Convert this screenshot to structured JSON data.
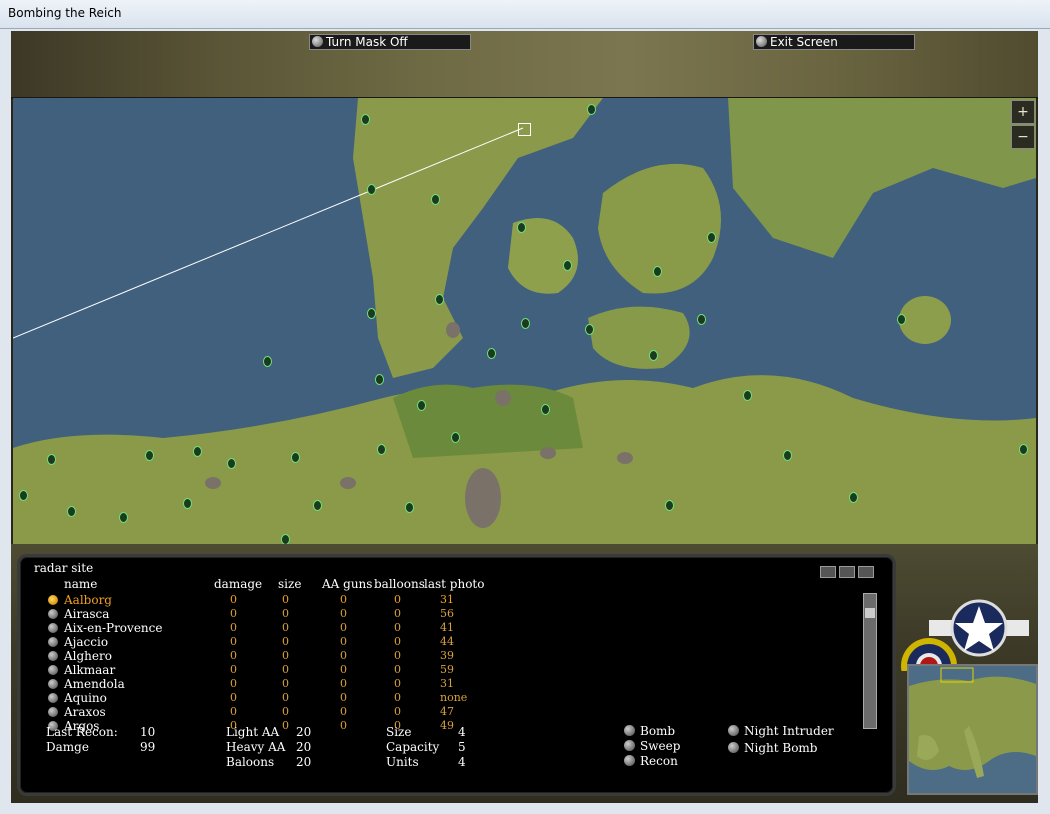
{
  "window": {
    "title": "Bombing the Reich"
  },
  "toolbar": {
    "mask_button": "Turn Mask Off",
    "exit_button": "Exit Screen"
  },
  "map": {
    "zoom_in": "+",
    "zoom_out": "−"
  },
  "panel": {
    "title": "radar site",
    "columns": [
      "name",
      "damage",
      "size",
      "AA guns",
      "balloons",
      "last photo"
    ],
    "rows": [
      {
        "name": "Aalborg",
        "damage": "0",
        "size": "0",
        "aa": "0",
        "balloons": "0",
        "photo": "31",
        "selected": true
      },
      {
        "name": "Airasca",
        "damage": "0",
        "size": "0",
        "aa": "0",
        "balloons": "0",
        "photo": "56"
      },
      {
        "name": "Aix-en-Provence",
        "damage": "0",
        "size": "0",
        "aa": "0",
        "balloons": "0",
        "photo": "41"
      },
      {
        "name": "Ajaccio",
        "damage": "0",
        "size": "0",
        "aa": "0",
        "balloons": "0",
        "photo": "44"
      },
      {
        "name": "Alghero",
        "damage": "0",
        "size": "0",
        "aa": "0",
        "balloons": "0",
        "photo": "39"
      },
      {
        "name": "Alkmaar",
        "damage": "0",
        "size": "0",
        "aa": "0",
        "balloons": "0",
        "photo": "59"
      },
      {
        "name": "Amendola",
        "damage": "0",
        "size": "0",
        "aa": "0",
        "balloons": "0",
        "photo": "31"
      },
      {
        "name": "Aquino",
        "damage": "0",
        "size": "0",
        "aa": "0",
        "balloons": "0",
        "photo": "none"
      },
      {
        "name": "Araxos",
        "damage": "0",
        "size": "0",
        "aa": "0",
        "balloons": "0",
        "photo": "47"
      },
      {
        "name": "Argos",
        "damage": "0",
        "size": "0",
        "aa": "0",
        "balloons": "0",
        "photo": "49"
      }
    ],
    "stats": {
      "last_recon_label": "Last Recon:",
      "last_recon": "10",
      "damage_label": "Damge",
      "damage": "99",
      "light_aa_label": "Light AA",
      "light_aa": "20",
      "heavy_aa_label": "Heavy AA",
      "heavy_aa": "20",
      "balloons_label": "Baloons",
      "balloons": "20",
      "size_label": "Size",
      "size": "4",
      "capacity_label": "Capacity",
      "capacity": "5",
      "units_label": "Units",
      "units": "4"
    },
    "missions": {
      "bomb": "Bomb",
      "sweep": "Sweep",
      "recon": "Recon",
      "night_intruder": "Night Intruder",
      "night_bomb": "Night Bomb"
    }
  },
  "colors": {
    "selected": "#f0a020",
    "marker": "#6fe07a"
  }
}
